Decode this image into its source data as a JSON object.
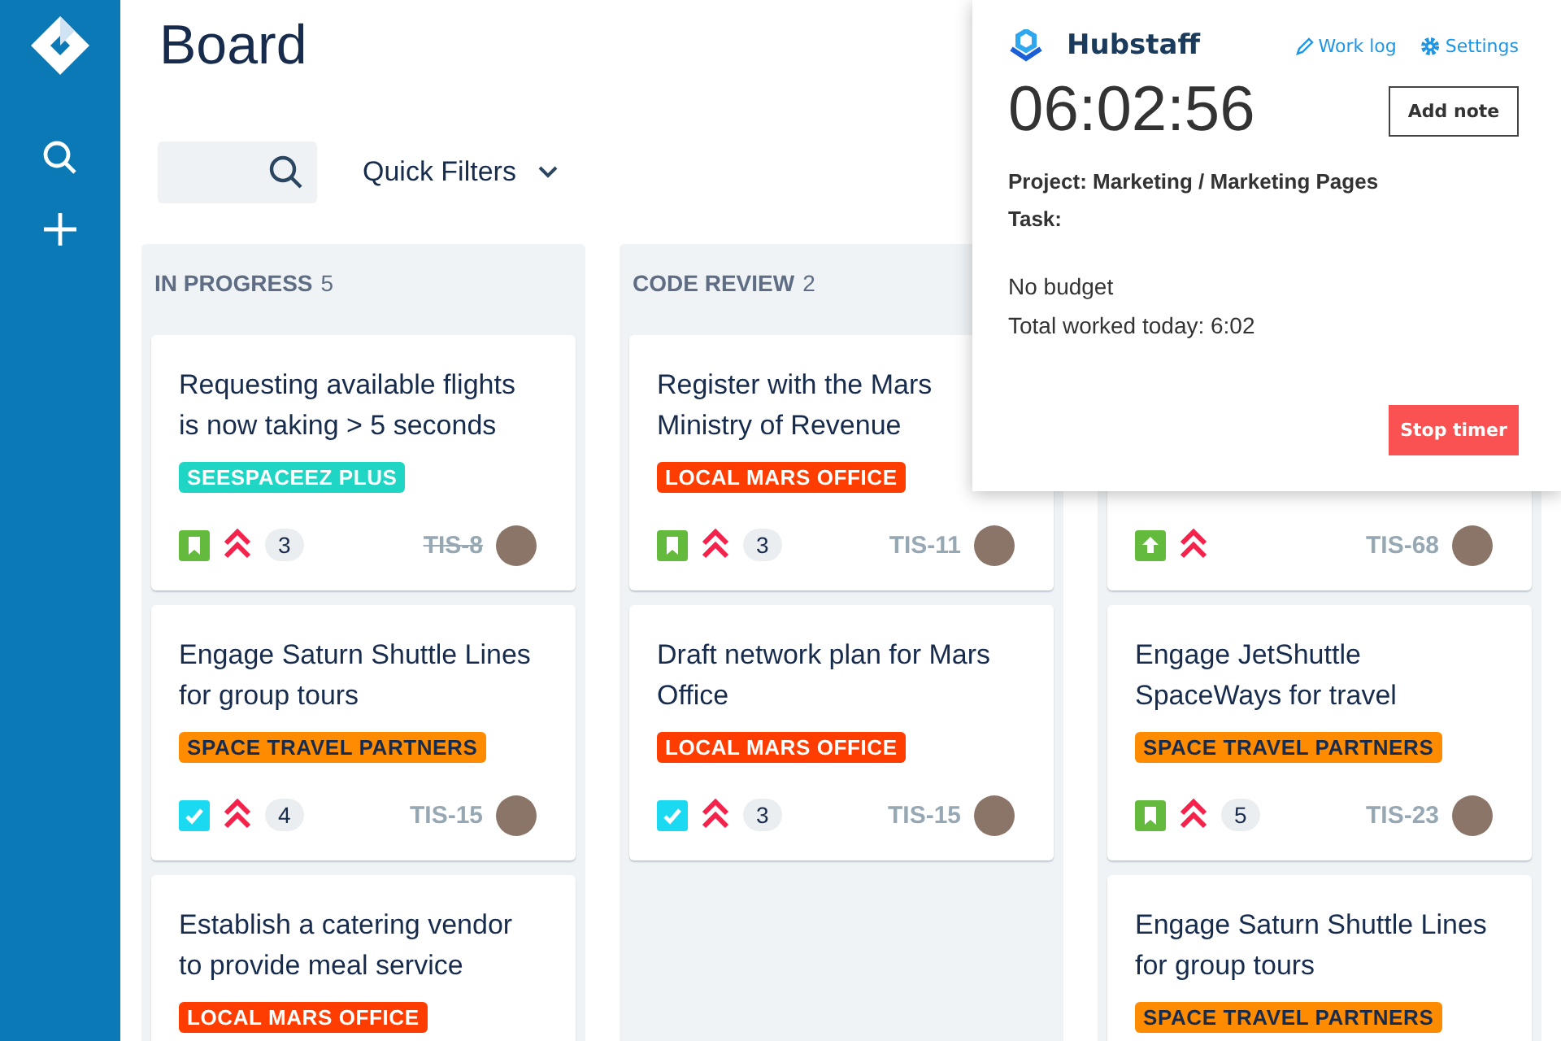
{
  "page": {
    "title": "Board"
  },
  "toolbar": {
    "quick_filters": "Quick Filters"
  },
  "columns": [
    {
      "title": "IN PROGRESS",
      "count": "5",
      "cards": [
        {
          "title": "Requesting available flights is now taking > 5 seconds",
          "label": {
            "text": "SEESPACEEZ PLUS",
            "color": "#1fd6c4"
          },
          "kind": "story",
          "comments": "3",
          "key": "TIS-8",
          "done": true
        },
        {
          "title": "Engage Saturn Shuttle Lines for group tours",
          "label": {
            "text": "SPACE TRAVEL PARTNERS",
            "color": "#ff8b00"
          },
          "kind": "task",
          "comments": "4",
          "key": "TIS-15",
          "done": false
        },
        {
          "title": "Establish a catering vendor to provide meal service",
          "label": {
            "text": "LOCAL MARS OFFICE",
            "color": "#ff3d00"
          }
        }
      ]
    },
    {
      "title": "CODE REVIEW",
      "count": "2",
      "cards": [
        {
          "title": "Register with the Mars Ministry of Revenue",
          "label": {
            "text": "LOCAL MARS OFFICE",
            "color": "#ff3d00"
          },
          "kind": "story",
          "comments": "3",
          "key": "TIS-11",
          "done": false
        },
        {
          "title": "Draft network plan for Mars Office",
          "label": {
            "text": "LOCAL MARS OFFICE",
            "color": "#ff3d00"
          },
          "kind": "task",
          "comments": "3",
          "key": "TIS-15",
          "done": false
        }
      ]
    },
    {
      "cards": [
        {
          "kind": "improvement",
          "key": "TIS-68",
          "done": false
        },
        {
          "title": "Engage JetShuttle SpaceWays for travel",
          "label": {
            "text": "SPACE TRAVEL PARTNERS",
            "color": "#ff8b00"
          },
          "kind": "story",
          "comments": "5",
          "key": "TIS-23",
          "done": false
        },
        {
          "title": "Engage Saturn Shuttle Lines for group tours",
          "label": {
            "text": "SPACE TRAVEL PARTNERS",
            "color": "#ff8b00"
          }
        }
      ]
    }
  ],
  "timer_popup": {
    "brand": "Hubstaff",
    "links": [
      "Work log",
      "Settings"
    ],
    "time": "06:02:56",
    "add_note": "Add note",
    "project": "Project: Marketing / Marketing Pages",
    "task": "Task:",
    "budget": "No budget",
    "total": "Total worked today: 6:02",
    "stop": "Stop timer"
  }
}
